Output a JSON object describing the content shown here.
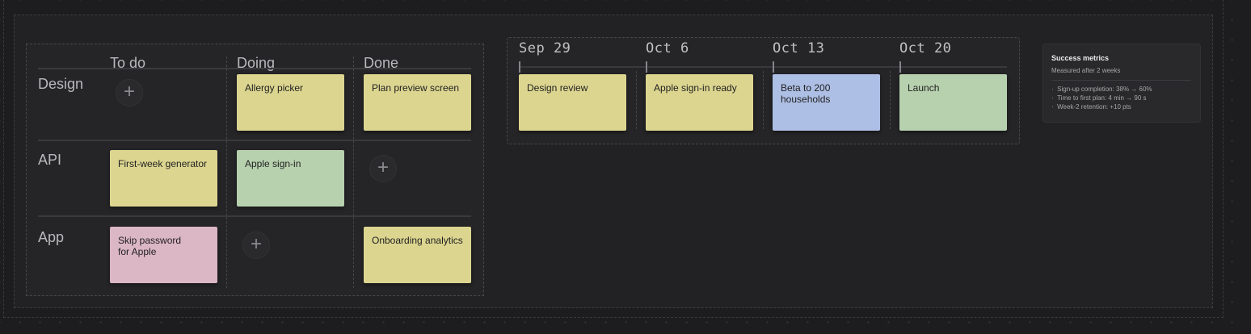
{
  "board": {
    "columns": [
      "To do",
      "Doing",
      "Done"
    ],
    "rows": [
      "Design",
      "API",
      "App"
    ],
    "cards": {
      "design_doing": "Allergy picker",
      "design_done": "Plan preview screen",
      "api_todo": "First-week generator",
      "api_doing": "Apple sign-in",
      "app_todo": "Skip password\nfor Apple",
      "app_done": "Onboarding analytics"
    },
    "add_symbol": "+"
  },
  "timeline": {
    "weeks": [
      "Sep 29",
      "Oct 6",
      "Oct 13",
      "Oct 20"
    ],
    "cards": [
      "Design review",
      "Apple sign-in ready",
      "Beta to 200\nhouseholds",
      "Launch"
    ]
  },
  "metrics": {
    "title": "Success metrics",
    "subtitle": "Measured after 2 weeks",
    "items": [
      "Sign-up completion: 38% → 60%",
      "Time to first plan: 4 min → 90 s",
      "Week-2 retention: +10 pts"
    ],
    "bullet": "·"
  },
  "colors": {
    "yellow": "#dcd590",
    "green": "#b7d1ae",
    "pink": "#dbb6c5",
    "blue": "#aebfe5",
    "canvas": "#1d1d1f"
  }
}
